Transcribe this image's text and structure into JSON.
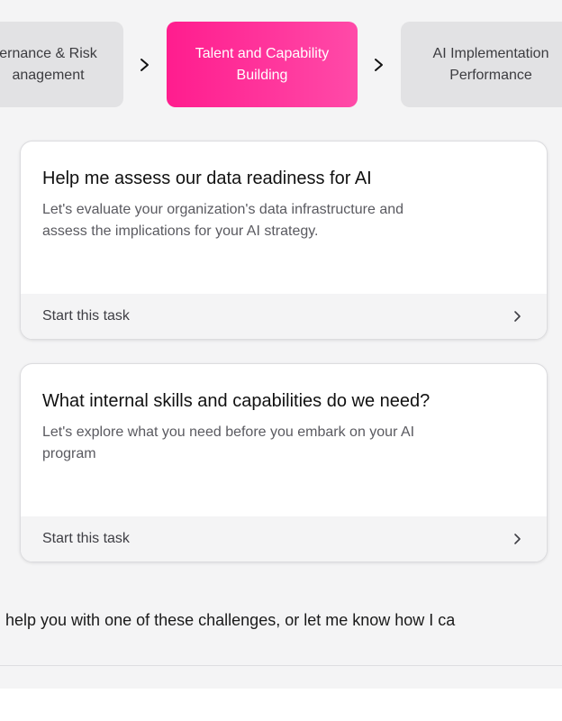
{
  "stepper": {
    "steps": [
      {
        "label": "ernance & Risk\nanagement",
        "state": "previous"
      },
      {
        "label": "Talent and Capability\nBuilding",
        "state": "active"
      },
      {
        "label": "AI Implementation\nPerformance",
        "state": "next"
      }
    ],
    "arrow_icon": "chevron-right-icon",
    "active_colors": [
      "#ff1d8e",
      "#ff4aa8"
    ]
  },
  "cards": [
    {
      "title": "Help me assess our data readiness for AI",
      "description": "Let's evaluate your organization's data infrastructure and\nassess the implications for your AI strategy.",
      "action_label": "Start this task",
      "action_icon": "chevron-right-icon"
    },
    {
      "title": "What internal skills and capabilities do we need?",
      "description": "Let's explore what you need before you embark on your AI\nprogram",
      "action_label": "Start this task",
      "action_icon": "chevron-right-icon"
    }
  ],
  "message": {
    "text": " help you with one of these challenges, or let me know how I ca"
  }
}
